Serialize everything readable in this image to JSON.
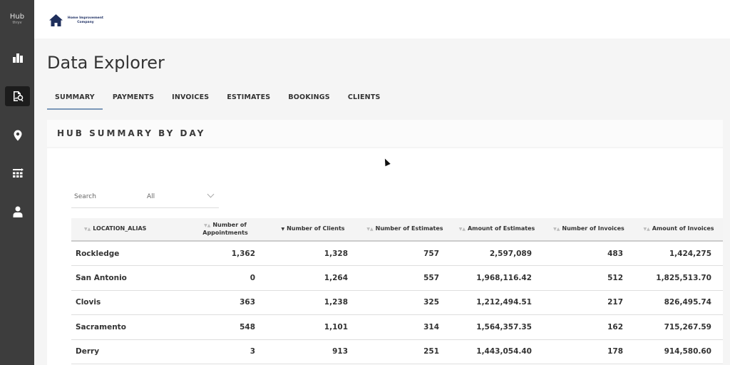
{
  "brand": {
    "name": "Hub",
    "sub": "thryv"
  },
  "logo": {
    "text": "Home Improvement Company"
  },
  "sidebar": {
    "items": [
      {
        "icon": "bar-chart-icon",
        "active": false
      },
      {
        "icon": "data-explorer-icon",
        "active": true
      },
      {
        "icon": "location-pin-icon",
        "active": false
      },
      {
        "icon": "calendar-grid-icon",
        "active": false
      },
      {
        "icon": "user-icon",
        "active": false
      }
    ]
  },
  "header": {
    "title": "Data Explorer"
  },
  "tabs": [
    {
      "label": "SUMMARY",
      "active": true
    },
    {
      "label": "PAYMENTS"
    },
    {
      "label": "INVOICES"
    },
    {
      "label": "ESTIMATES"
    },
    {
      "label": "BOOKINGS"
    },
    {
      "label": "CLIENTS"
    }
  ],
  "section": {
    "title": "HUB SUMMARY BY DAY"
  },
  "filters": {
    "search_label": "Search",
    "select_value": "All"
  },
  "table": {
    "columns": [
      {
        "label": "LOCATION_ALIAS",
        "sort": "none"
      },
      {
        "label": "Number of Appointments",
        "sort": "none"
      },
      {
        "label": "Number of Clients",
        "sort": "desc"
      },
      {
        "label": "Number of Estimates",
        "sort": "none"
      },
      {
        "label": "Amount of Estimates",
        "sort": "none"
      },
      {
        "label": "Number of Invoices",
        "sort": "none"
      },
      {
        "label": "Amount of Invoices",
        "sort": "none"
      }
    ],
    "rows": [
      [
        "Rockledge",
        "1,362",
        "1,328",
        "757",
        "2,597,089",
        "483",
        "1,424,275"
      ],
      [
        "San Antonio",
        "0",
        "1,264",
        "557",
        "1,968,116.42",
        "512",
        "1,825,513.70"
      ],
      [
        "Clovis",
        "363",
        "1,238",
        "325",
        "1,212,494.51",
        "217",
        "826,495.74"
      ],
      [
        "Sacramento",
        "548",
        "1,101",
        "314",
        "1,564,357.35",
        "162",
        "715,267.59"
      ],
      [
        "Derry",
        "3",
        "913",
        "251",
        "1,443,054.40",
        "178",
        "914,580.60"
      ]
    ]
  }
}
